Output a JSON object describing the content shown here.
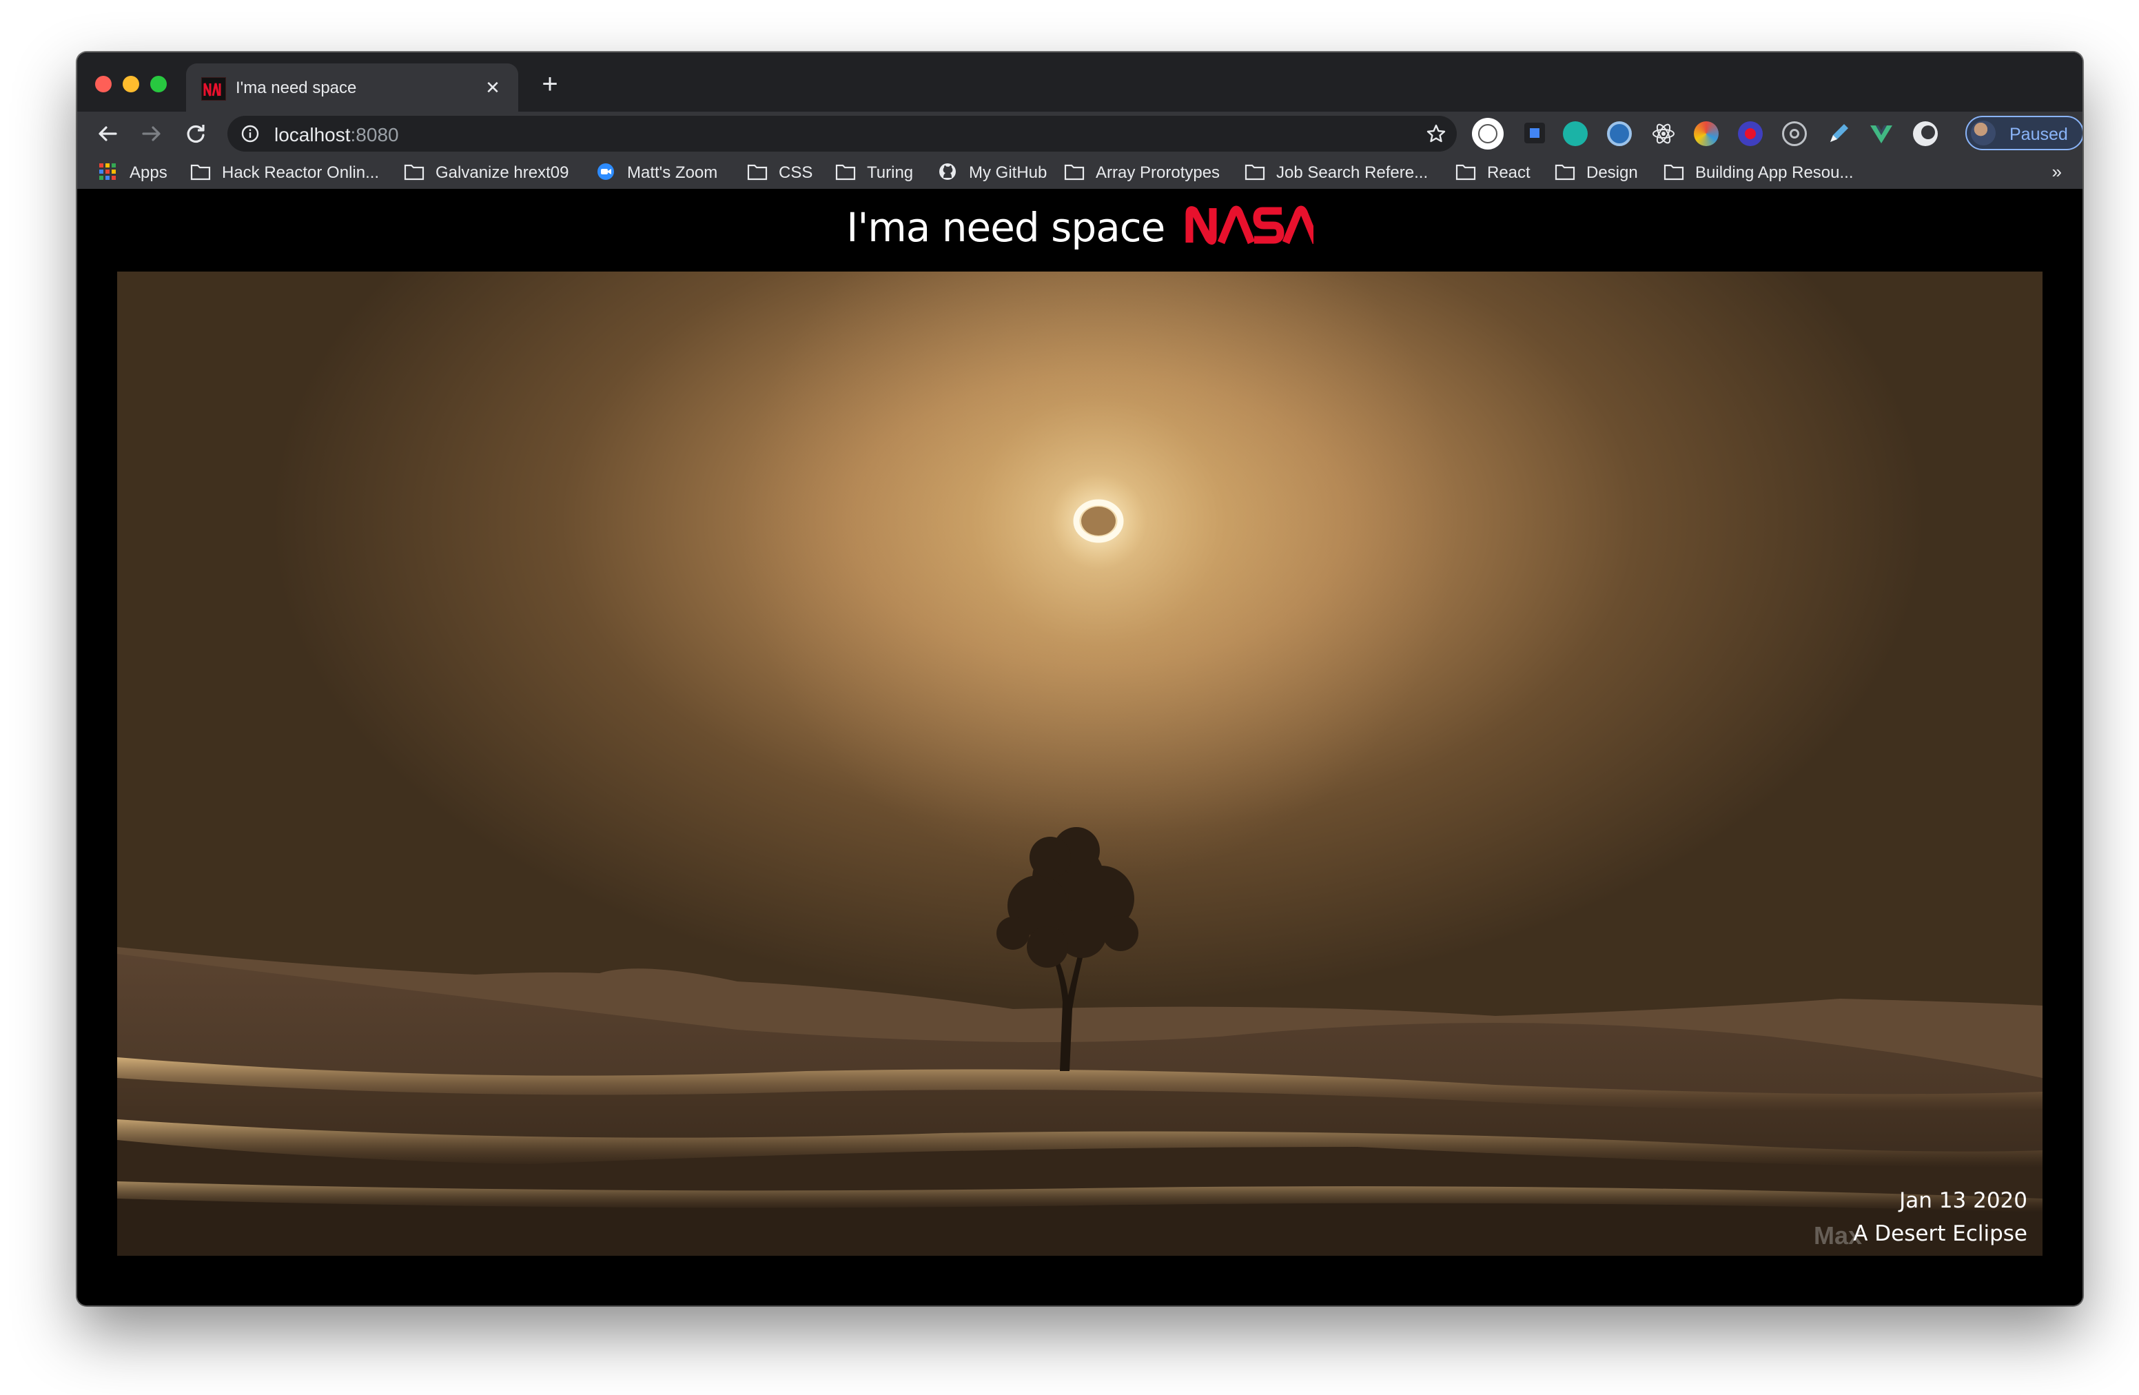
{
  "browser": {
    "tab_title": "I'ma need space",
    "url_host": "localhost",
    "url_port": ":8080",
    "profile_label": "Paused",
    "bookmarks": [
      {
        "label": "Apps",
        "icon": "apps-grid-icon"
      },
      {
        "label": "Hack Reactor Onlin...",
        "icon": "folder-icon"
      },
      {
        "label": "Galvanize hrext09",
        "icon": "folder-icon"
      },
      {
        "label": "Matt's Zoom",
        "icon": "zoom-icon"
      },
      {
        "label": "CSS",
        "icon": "folder-icon"
      },
      {
        "label": "Turing",
        "icon": "folder-icon"
      },
      {
        "label": "My GitHub",
        "icon": "github-icon"
      },
      {
        "label": "Array Prorotypes",
        "icon": "folder-icon"
      },
      {
        "label": "Job Search Refere...",
        "icon": "folder-icon"
      },
      {
        "label": "React",
        "icon": "folder-icon"
      },
      {
        "label": "Design",
        "icon": "folder-icon"
      },
      {
        "label": "Building App Resou...",
        "icon": "folder-icon"
      }
    ],
    "bookmark_overflow": "»"
  },
  "site": {
    "title": "I'ma need space",
    "logo_text": "NASA",
    "photo_date": "Jan 13 2020",
    "photo_title": "A Desert Eclipse",
    "watermark": "Max"
  },
  "colors": {
    "nasa_red": "#e8112d",
    "tab_strip": "#202124",
    "toolbar": "#35363a",
    "profile_accent": "#8ab4f8"
  }
}
